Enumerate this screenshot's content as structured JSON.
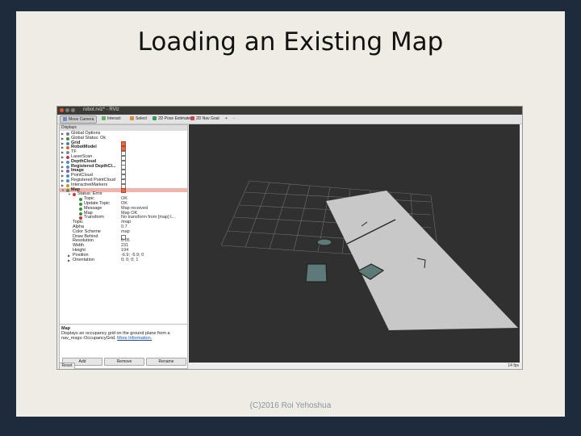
{
  "slide": {
    "title": "Loading an Existing Map",
    "footer": "(C)2016 Roi Yehoshua"
  },
  "window": {
    "title": "robot.rviz* - RViz"
  },
  "toolbar": [
    {
      "label": "Move Camera",
      "icon": "move-camera-icon",
      "active": true
    },
    {
      "label": "Interact",
      "icon": "interact-icon",
      "active": false
    },
    {
      "label": "Select",
      "icon": "select-icon",
      "active": false
    },
    {
      "label": "2D Pose Estimate",
      "icon": "pose-estimate-icon",
      "active": false
    },
    {
      "label": "2D Nav Goal",
      "icon": "nav-goal-icon",
      "active": false
    }
  ],
  "displays_panel": {
    "title": "Displays",
    "items": [
      {
        "label": "Global Options",
        "icon": "gear-icon",
        "value": "",
        "check": null,
        "indent": 1,
        "expander": true,
        "bold": false
      },
      {
        "label": "Global Status: Ok",
        "icon": "check-icon",
        "value": "",
        "check": null,
        "indent": 1,
        "expander": true,
        "bold": false
      },
      {
        "label": "Grid",
        "icon": "grid-icon",
        "value": "",
        "check": true,
        "indent": 1,
        "expander": true,
        "bold": true
      },
      {
        "label": "RobotModel",
        "icon": "robot-model-icon",
        "value": "",
        "check": true,
        "indent": 1,
        "expander": true,
        "bold": true
      },
      {
        "label": "TF",
        "icon": "tf-icon",
        "value": "",
        "check": false,
        "indent": 1,
        "expander": true,
        "bold": false
      },
      {
        "label": "LaserScan",
        "icon": "laser-icon",
        "value": "",
        "check": false,
        "indent": 1,
        "expander": true,
        "bold": false
      },
      {
        "label": "DepthCloud",
        "icon": "cloud-icon",
        "value": "",
        "check": false,
        "indent": 1,
        "expander": true,
        "bold": true
      },
      {
        "label": "Registered DepthCl...",
        "icon": "cloud-icon",
        "value": "",
        "check": false,
        "indent": 1,
        "expander": true,
        "bold": true
      },
      {
        "label": "Image",
        "icon": "image-icon",
        "value": "",
        "check": false,
        "indent": 1,
        "expander": true,
        "bold": true
      },
      {
        "label": "PointCloud",
        "icon": "cloud-icon",
        "value": "",
        "check": false,
        "indent": 1,
        "expander": true,
        "bold": false
      },
      {
        "label": "Registered PointCloud",
        "icon": "cloud-icon",
        "value": "",
        "check": false,
        "indent": 1,
        "expander": true,
        "bold": false
      },
      {
        "label": "InteractiveMarkers",
        "icon": "marker-icon",
        "value": "",
        "check": false,
        "indent": 1,
        "expander": true,
        "bold": false
      },
      {
        "label": "Map",
        "icon": "map-icon",
        "value": "",
        "check": true,
        "indent": 1,
        "expander": true,
        "bold": true,
        "selected": true
      },
      {
        "label": "Status: Error",
        "icon": "error-icon",
        "value": "",
        "check": null,
        "indent": 2,
        "expander": true,
        "bold": false
      },
      {
        "label": "Topic",
        "icon": "check-icon",
        "value": "OK",
        "check": null,
        "indent": 3,
        "expander": false,
        "bold": false
      },
      {
        "label": "Update Topic",
        "icon": "check-icon",
        "value": "OK",
        "check": null,
        "indent": 3,
        "expander": false,
        "bold": false
      },
      {
        "label": "Message",
        "icon": "check-icon",
        "value": "Map received",
        "check": null,
        "indent": 3,
        "expander": false,
        "bold": false
      },
      {
        "label": "Map",
        "icon": "check-icon",
        "value": "Map OK",
        "check": null,
        "indent": 3,
        "expander": false,
        "bold": false
      },
      {
        "label": "Transform",
        "icon": "error-icon",
        "value": "No transform from [map] t...",
        "check": null,
        "indent": 3,
        "expander": false,
        "bold": false
      },
      {
        "label": "Topic",
        "icon": "",
        "value": "/map",
        "check": null,
        "indent": 2,
        "expander": false,
        "bold": false
      },
      {
        "label": "Alpha",
        "icon": "",
        "value": "0.7",
        "check": null,
        "indent": 2,
        "expander": false,
        "bold": false
      },
      {
        "label": "Color Scheme",
        "icon": "",
        "value": "map",
        "check": null,
        "indent": 2,
        "expander": false,
        "bold": false
      },
      {
        "label": "Draw Behind",
        "icon": "",
        "value": "",
        "check": false,
        "indent": 2,
        "expander": false,
        "bold": false
      },
      {
        "label": "Resolution",
        "icon": "",
        "value": "0.05",
        "check": null,
        "indent": 2,
        "expander": false,
        "bold": false
      },
      {
        "label": "Width",
        "icon": "",
        "value": "231",
        "check": null,
        "indent": 2,
        "expander": false,
        "bold": false
      },
      {
        "label": "Height",
        "icon": "",
        "value": "194",
        "check": null,
        "indent": 2,
        "expander": false,
        "bold": false
      },
      {
        "label": "Position",
        "icon": "",
        "value": "-6.9; -5.9; 0",
        "check": null,
        "indent": 2,
        "expander": true,
        "bold": false
      },
      {
        "label": "Orientation",
        "icon": "",
        "value": "0; 0; 0; 1",
        "check": null,
        "indent": 2,
        "expander": true,
        "bold": false
      }
    ]
  },
  "description": {
    "title": "Map",
    "text": "Displays an occupancy grid on the ground plane from a nav_msgs::OccupancyGrid.",
    "link": "More Information."
  },
  "panel_buttons": {
    "add": "Add",
    "remove": "Remove",
    "rename": "Rename"
  },
  "reset_button": "Reset",
  "status": {
    "fps": "14 fps"
  },
  "colors": {
    "slide_bg": "#eeece3",
    "frame_bg": "#1d2b3d",
    "selection": "#f0b5aa",
    "viewport_bg": "#303030",
    "map_floor": "#c8c8c8"
  }
}
